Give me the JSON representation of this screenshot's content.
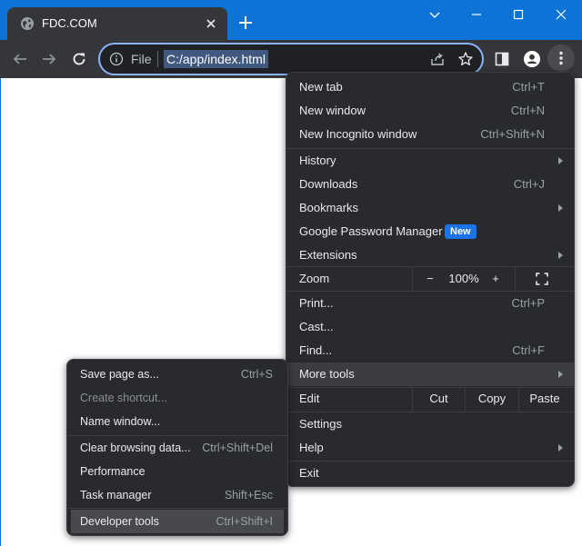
{
  "tab": {
    "title": "FDC.COM"
  },
  "omnibox": {
    "scheme_label": "File",
    "url": "C:/app/index.html"
  },
  "menu": {
    "new_tab": {
      "label": "New tab",
      "shortcut": "Ctrl+T"
    },
    "new_window": {
      "label": "New window",
      "shortcut": "Ctrl+N"
    },
    "new_incognito": {
      "label": "New Incognito window",
      "shortcut": "Ctrl+Shift+N"
    },
    "history": {
      "label": "History"
    },
    "downloads": {
      "label": "Downloads",
      "shortcut": "Ctrl+J"
    },
    "bookmarks": {
      "label": "Bookmarks"
    },
    "password_manager": {
      "label": "Google Password Manager",
      "badge": "New"
    },
    "extensions": {
      "label": "Extensions"
    },
    "zoom": {
      "label": "Zoom",
      "minus": "−",
      "value": "100%",
      "plus": "+"
    },
    "print": {
      "label": "Print...",
      "shortcut": "Ctrl+P"
    },
    "cast": {
      "label": "Cast..."
    },
    "find": {
      "label": "Find...",
      "shortcut": "Ctrl+F"
    },
    "more_tools": {
      "label": "More tools"
    },
    "edit": {
      "label": "Edit",
      "cut": "Cut",
      "copy": "Copy",
      "paste": "Paste"
    },
    "settings": {
      "label": "Settings"
    },
    "help": {
      "label": "Help"
    },
    "exit": {
      "label": "Exit"
    }
  },
  "submenu": {
    "save_page": {
      "label": "Save page as...",
      "shortcut": "Ctrl+S"
    },
    "create_shortcut": {
      "label": "Create shortcut..."
    },
    "name_window": {
      "label": "Name window..."
    },
    "clear_browsing": {
      "label": "Clear browsing data...",
      "shortcut": "Ctrl+Shift+Del"
    },
    "performance": {
      "label": "Performance"
    },
    "task_manager": {
      "label": "Task manager",
      "shortcut": "Shift+Esc"
    },
    "developer_tools": {
      "label": "Developer tools",
      "shortcut": "Ctrl+Shift+I"
    }
  },
  "colors": {
    "titlebar": "#0d73d6",
    "toolbar": "#35363a",
    "menu_bg": "#292a2d",
    "accent_badge": "#1a73e8",
    "url_selection": "#41587f"
  },
  "icons": {
    "favicon": "globe-icon",
    "tab_close": "close-icon",
    "new_tab": "plus-icon",
    "window": [
      "chevron-down-icon",
      "minimize-icon",
      "maximize-icon",
      "window-close-icon"
    ],
    "toolbar": [
      "back-arrow-icon",
      "forward-arrow-icon",
      "reload-icon",
      "info-icon",
      "share-icon",
      "star-icon",
      "side-panel-icon",
      "profile-icon",
      "kebab-menu-icon"
    ],
    "zoom": "fullscreen-icon"
  }
}
